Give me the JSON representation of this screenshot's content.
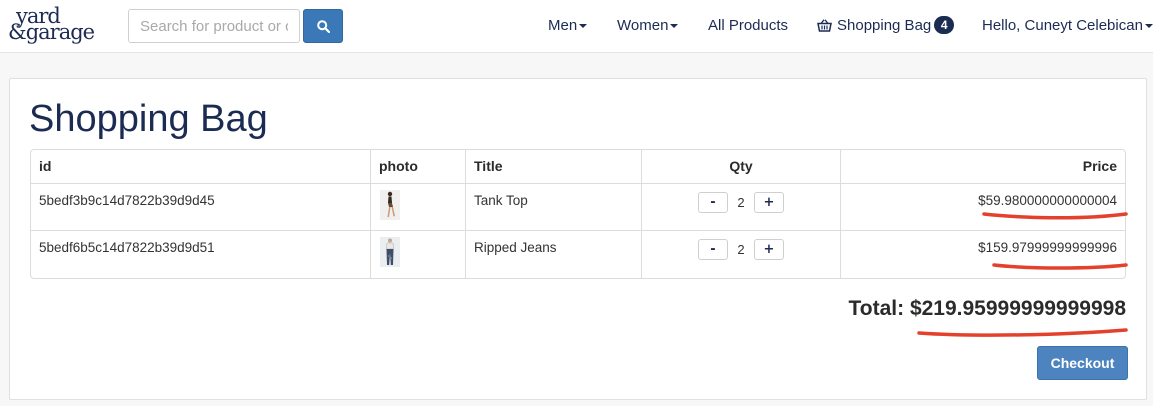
{
  "brand": {
    "line1": "yard",
    "line2": "&garage"
  },
  "search": {
    "placeholder": "Search for product or c",
    "value": ""
  },
  "nav": {
    "men": "Men",
    "women": "Women",
    "all_products": "All Products",
    "shopping_bag": "Shopping Bag",
    "bag_count": "4",
    "greeting": "Hello, Cuneyt Celebican"
  },
  "page": {
    "title": "Shopping Bag"
  },
  "table": {
    "headers": {
      "id": "id",
      "photo": "photo",
      "title": "Title",
      "qty": "Qty",
      "price": "Price"
    },
    "rows": [
      {
        "id": "5bedf3b9c14d7822b39d9d45",
        "title": "Tank Top",
        "qty": "2",
        "price": "$59.980000000000004",
        "photo_icon": "tank-top-photo"
      },
      {
        "id": "5bedf6b5c14d7822b39d9d51",
        "title": "Ripped Jeans",
        "qty": "2",
        "price": "$159.97999999999996",
        "photo_icon": "ripped-jeans-photo"
      }
    ],
    "minus_label": "-",
    "plus_label": "+"
  },
  "total": {
    "label": "Total:",
    "value": "$219.95999999999998"
  },
  "checkout_label": "Checkout",
  "colors": {
    "brand_navy": "#1c2b52",
    "button_blue": "#4d84c0",
    "annotation_red": "#e4412c"
  }
}
